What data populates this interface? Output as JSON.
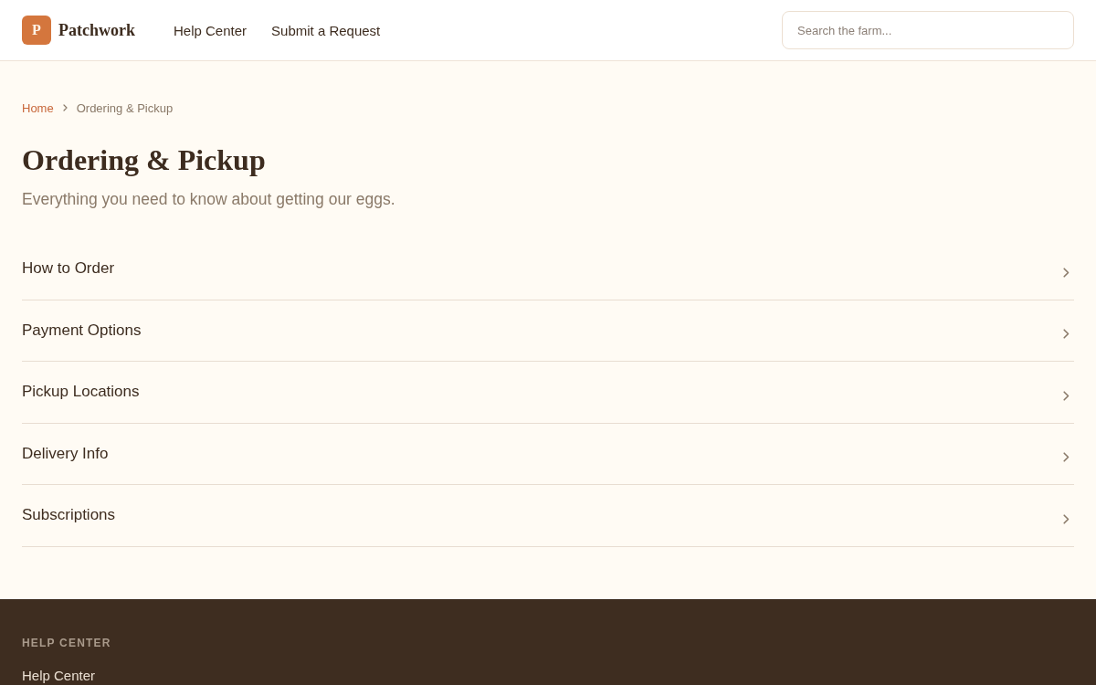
{
  "header": {
    "logo": {
      "letter": "P",
      "name": "Patchwork"
    },
    "nav": [
      {
        "label": "Help Center"
      },
      {
        "label": "Submit a Request"
      }
    ],
    "search": {
      "placeholder": "Search the farm..."
    }
  },
  "breadcrumb": [
    {
      "label": "Home",
      "kind": "link"
    },
    {
      "label": "Ordering & Pickup",
      "kind": "current"
    }
  ],
  "page": {
    "title": "Ordering & Pickup",
    "subtitle": "Everything you need to know about getting our eggs."
  },
  "topics": [
    {
      "label": "How to Order"
    },
    {
      "label": "Payment Options"
    },
    {
      "label": "Pickup Locations"
    },
    {
      "label": "Delivery Info"
    },
    {
      "label": "Subscriptions"
    }
  ],
  "footer": {
    "heading": "HELP CENTER",
    "links": [
      {
        "label": "Help Center"
      }
    ]
  }
}
